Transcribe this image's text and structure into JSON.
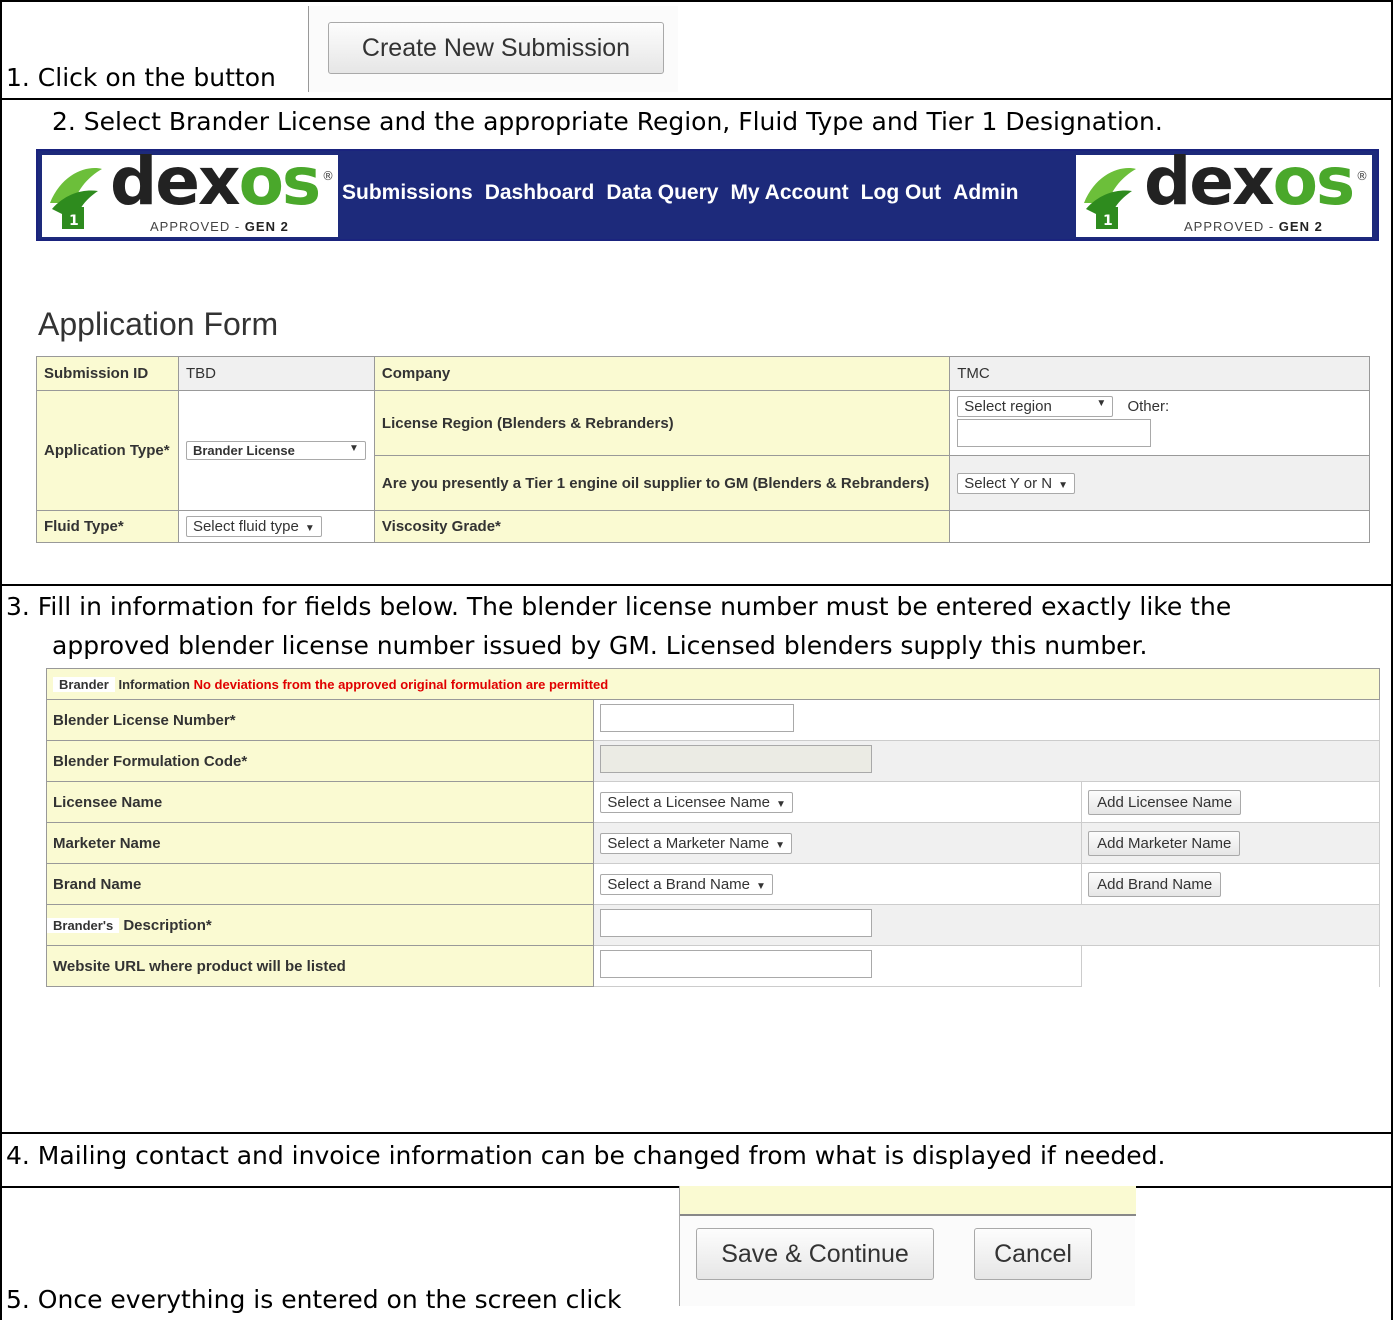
{
  "steps": {
    "s1": "1. Click on the button",
    "s2": "2.  Select Brander License and the appropriate Region, Fluid Type and Tier 1 Designation.",
    "s3_line1": "3. Fill in information for fields below.  The blender license number must be entered exactly like the",
    "s3_line2": "approved blender license number issued by GM.  Licensed blenders supply this number.",
    "s4": "4. Mailing contact and invoice information can be changed from what is displayed if needed.",
    "s5": "5.  Once everything is entered on the screen click"
  },
  "create_button": "Create New Submission",
  "logo": {
    "word_left": "dex",
    "word_right": "os",
    "reg": "®",
    "approved": "APPROVED - ",
    "gen": "GEN 2",
    "badge": "1"
  },
  "nav": [
    "Submissions",
    "Dashboard",
    "Data Query",
    "My Account",
    "Log Out",
    "Admin"
  ],
  "form_title": "Application Form",
  "app_form": {
    "submission_id_label": "Submission ID",
    "submission_id_value": "TBD",
    "company_label": "Company",
    "company_value": "TMC",
    "application_type_label": "Application Type*",
    "application_type_value": "Brander License",
    "license_region_label": "License Region (Blenders & Rebranders)",
    "region_select": "Select region",
    "other_label": "Other:",
    "tier1_label": "Are you presently a Tier 1 engine oil supplier to GM (Blenders & Rebranders)",
    "tier1_select": "Select Y or N",
    "fluid_type_label": "Fluid Type*",
    "fluid_type_select": "Select fluid type",
    "viscosity_label": "Viscosity Grade*"
  },
  "brander_form": {
    "header_tag": "Brander",
    "header_text": "Information",
    "header_warning": "No deviations from the approved original formulation are permitted",
    "blender_license_label": "Blender License Number*",
    "formulation_code_label": "Blender Formulation Code*",
    "licensee_label": "Licensee Name",
    "licensee_select": "Select a Licensee Name",
    "licensee_add": "Add Licensee Name",
    "marketer_label": "Marketer Name",
    "marketer_select": "Select a Marketer Name",
    "marketer_add": "Add Marketer Name",
    "brand_label": "Brand Name",
    "brand_select": "Select a Brand Name",
    "brand_add": "Add Brand Name",
    "description_tag": "Brander's",
    "description_label": "Description*",
    "website_label": "Website URL where product will be listed"
  },
  "save_button": "Save & Continue",
  "cancel_button": "Cancel",
  "colors": {
    "nav_bg": "#1d2a7b",
    "label_bg": "#fafad2",
    "warning": "#e00000",
    "logo_green": "#4aa82b"
  }
}
